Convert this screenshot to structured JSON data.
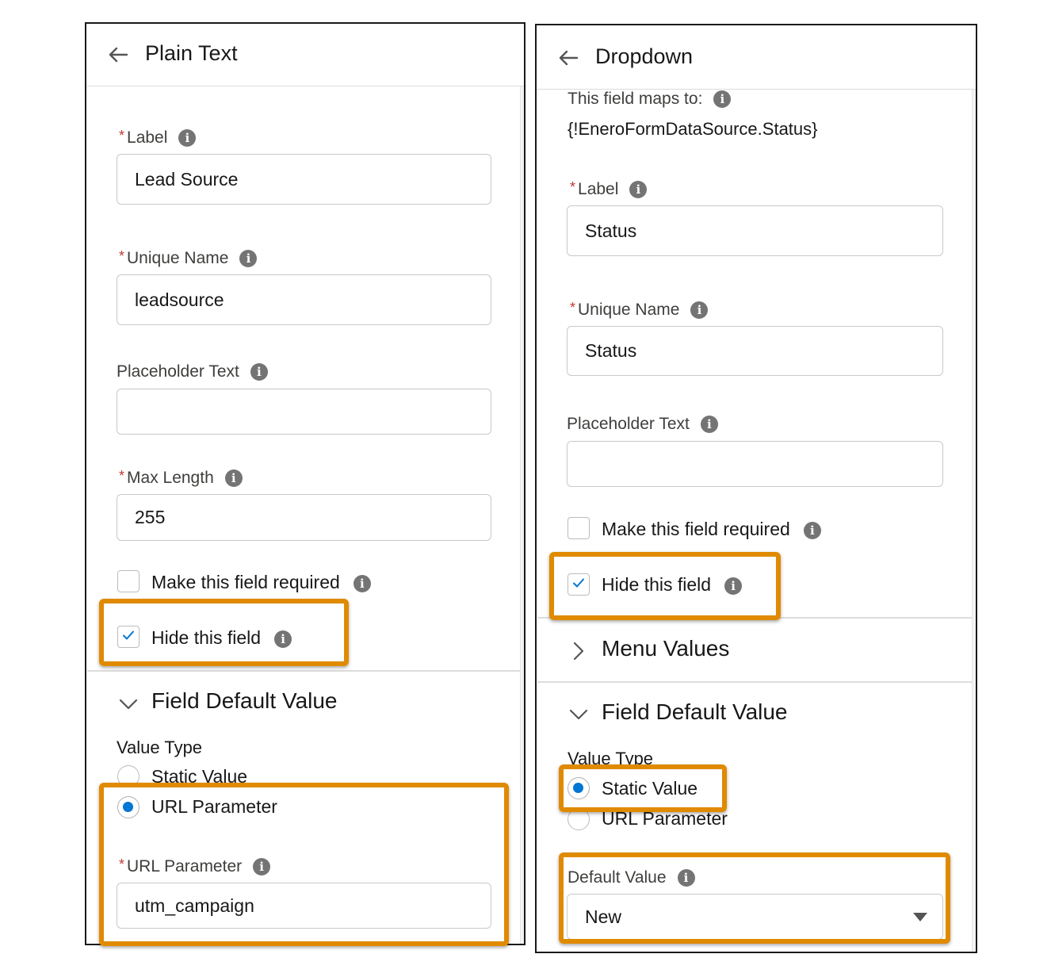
{
  "left": {
    "title": "Plain Text",
    "label_field": {
      "label": "Label",
      "value": "Lead Source"
    },
    "unique_name_field": {
      "label": "Unique Name",
      "value": "leadsource"
    },
    "placeholder_field": {
      "label": "Placeholder Text",
      "value": ""
    },
    "max_length_field": {
      "label": "Max Length",
      "value": "255"
    },
    "required_checkbox": {
      "label": "Make this field required",
      "checked": false
    },
    "hide_checkbox": {
      "label": "Hide this field",
      "checked": true
    },
    "default_section": {
      "title": "Field Default Value",
      "expanded": true
    },
    "value_type": {
      "label": "Value Type",
      "options": [
        "Static Value",
        "URL Parameter"
      ],
      "selected": "URL Parameter"
    },
    "url_param_field": {
      "label": "URL Parameter",
      "value": "utm_campaign"
    }
  },
  "right": {
    "title": "Dropdown",
    "maps_to": {
      "label": "This field maps to:",
      "value": "{!EneroFormDataSource.Status}"
    },
    "label_field": {
      "label": "Label",
      "value": "Status"
    },
    "unique_name_field": {
      "label": "Unique Name",
      "value": "Status"
    },
    "placeholder_field": {
      "label": "Placeholder Text",
      "value": ""
    },
    "required_checkbox": {
      "label": "Make this field required",
      "checked": false
    },
    "hide_checkbox": {
      "label": "Hide this field",
      "checked": true
    },
    "menu_section": {
      "title": "Menu Values",
      "expanded": false
    },
    "default_section": {
      "title": "Field Default Value",
      "expanded": true
    },
    "value_type": {
      "label": "Value Type",
      "options": [
        "Static Value",
        "URL Parameter"
      ],
      "selected": "Static Value"
    },
    "default_value_field": {
      "label": "Default Value",
      "value": "New"
    }
  },
  "colors": {
    "highlight": "#e08a00",
    "accent": "#0176d3",
    "required": "#c23934"
  },
  "icons": [
    "arrow-left-icon",
    "info-icon",
    "check-icon",
    "chevron-down-icon",
    "chevron-right-icon",
    "caret-down-icon"
  ]
}
